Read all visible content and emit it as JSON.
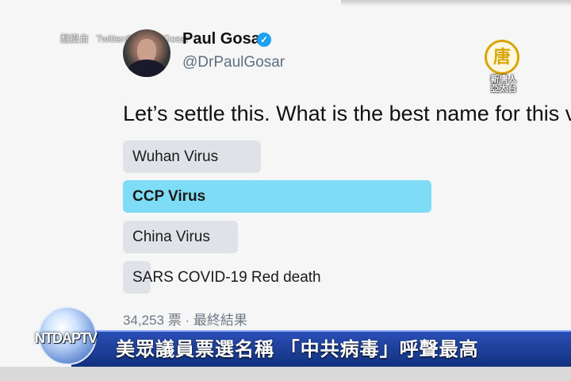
{
  "source_credit": {
    "prefix": "翻攝自",
    "account": "Twitter@DrPaulGosar"
  },
  "tweet": {
    "author_name": "Paul Gosar",
    "verified_mark": "✓",
    "handle": "@DrPaulGosar",
    "text": "Let’s settle this. What is the best name for this v"
  },
  "poll": {
    "options": [
      {
        "label": "Wuhan Virus",
        "share": 0.3
      },
      {
        "label": "CCP Virus",
        "share": 0.67,
        "winner": true
      },
      {
        "label": "China Virus",
        "share": 0.25
      },
      {
        "label": "SARS COVID-19 Red death",
        "share": 0.06
      }
    ],
    "meta": "34,253 票 · 最終結果"
  },
  "station": {
    "seal": "唐",
    "name": "新唐人\n亞太台"
  },
  "banner": {
    "logo": "NTDAPTV",
    "headline": "美眾議員票選名稱 「中共病毒」呼聲最高"
  },
  "colors": {
    "winner_bar": "#7fdcf6",
    "bar": "#dfe3e8",
    "banner": "#1f44a0",
    "verified": "#1da1f2"
  }
}
